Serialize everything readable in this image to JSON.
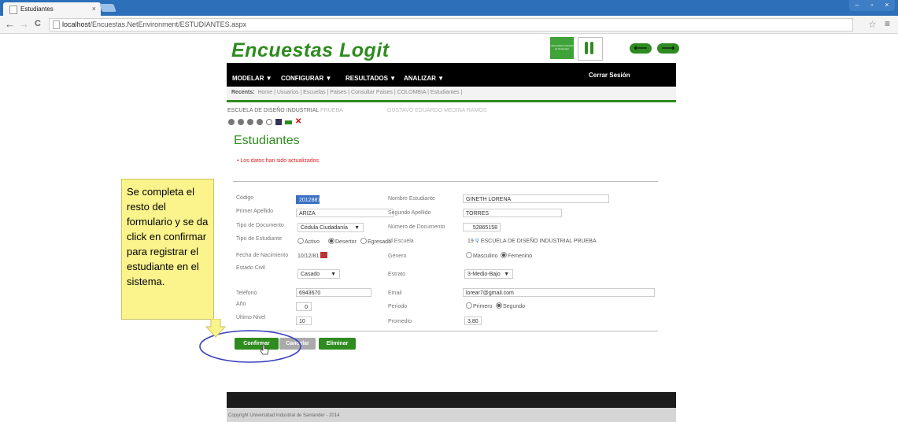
{
  "browser": {
    "tab_title": "Estudiantes",
    "tab_close": "×",
    "url_host": "localhost",
    "url_path": "/Encuestas.NetEnvironment/ESTUDIANTES.aspx",
    "back": "←",
    "forward": "→",
    "reload": "C",
    "star": "☆",
    "menu": "≡",
    "window_controls": [
      "–",
      "▫",
      "×"
    ]
  },
  "header": {
    "logo_text": "Encuestas Logit",
    "uis_small_text": "Universidad Industrial de Santander",
    "nav_left": "⟵",
    "nav_right": "⟶"
  },
  "menu": {
    "items": [
      "MODELAR ▼",
      "CONFIGURAR ▼",
      "RESULTADOS ▼",
      "ANALIZAR ▼"
    ],
    "logout": "Cerrar Sesión"
  },
  "recents": {
    "label": "Recents:",
    "items": "Home  |  Usuarios  |  Escuelas  |  Paises  |  Consultar Paises  |  COLOMBIA  |  Estudiantes  |"
  },
  "context": {
    "school": "ESCUELA DE DISEÑO INDUSTRIAL",
    "school_suffix": "PRUEBA",
    "user": "GUSTAVO EDUARDO MEDINA RAMOS"
  },
  "page": {
    "title": "Estudiantes",
    "notice": "Los datos han sido actualizados."
  },
  "form": {
    "codigo_label": "Código",
    "codigo_value": "2012887",
    "nombre_label": "Nombre Estudiante",
    "nombre_value": "GINETH LORENA",
    "primer_apellido_label": "Primer Apellido",
    "primer_apellido_value": "ARIZA",
    "segundo_apellido_label": "Segundo Apellido",
    "segundo_apellido_value": "TORRES",
    "tipo_doc_label": "Tipo de Documento",
    "tipo_doc_value": "Cédula Ciudadanía",
    "num_doc_label": "Número de Documento",
    "num_doc_value": "52865158",
    "tipo_est_label": "Tipo de Estudiante",
    "tipo_est_options": [
      "Activo",
      "Desertor",
      "Egresado"
    ],
    "tipo_est_selected": "Desertor",
    "id_escuela_label": "Id Escuela",
    "id_escuela_value": "19",
    "id_escuela_name": "ESCUELA DE DISEÑO INDUSTRIAL PRUEBA",
    "fecha_label": "Fecha de Nacimiento",
    "fecha_value": "10/12/81",
    "genero_label": "Género",
    "genero_options": [
      "Masculino",
      "Femenino"
    ],
    "genero_selected": "Femenino",
    "estado_civil_label": "Estado Civil",
    "estado_civil_value": "Casado",
    "estrato_label": "Estrato",
    "estrato_value": "3-Medio-Bajo",
    "telefono_label": "Teléfono",
    "telefono_value": "6943670",
    "email_label": "Email",
    "email_value": "lorear7@gmail.com",
    "anio_label": "Año",
    "anio_value": "0",
    "periodo_label": "Periodo",
    "periodo_options": [
      "Primero",
      "Segundo"
    ],
    "periodo_selected": "Segundo",
    "ultimo_nivel_label": "Último Nivel",
    "ultimo_nivel_value": "10",
    "promedio_label": "Promedio",
    "promedio_value": "3,80",
    "caret": "▼"
  },
  "buttons": {
    "confirmar": "Confirmar",
    "cancelar": "Cancelar",
    "eliminar": "Eliminar"
  },
  "callout": {
    "text": "Se completa el resto del formulario y se da click en confirmar para registrar el estudiante en el sistema."
  },
  "footer": {
    "copyright": "Copyright Universidad Industrial de Santander - 2014"
  },
  "colors": {
    "brand_green": "#2e8b1f",
    "callout_yellow": "#fbf48d",
    "highlight_ellipse": "#3a3fc1",
    "notice_red": "#e02020"
  }
}
